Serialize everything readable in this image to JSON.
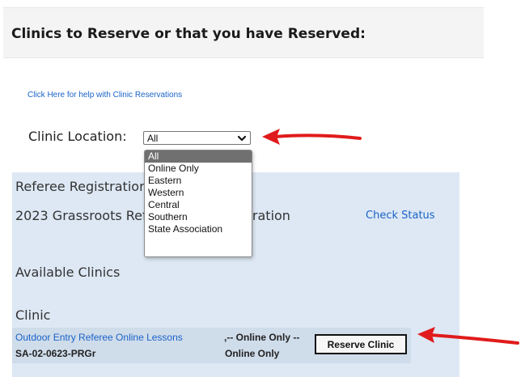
{
  "header": {
    "title": "Clinics to Reserve or that you have Reserved:"
  },
  "help_link": "Click Here for help with Clinic Reservations",
  "location": {
    "label": "Clinic Location:",
    "selected": "All",
    "options": [
      "All",
      "Online Only",
      "Eastern",
      "Western",
      "Central",
      "Southern",
      "State Association"
    ]
  },
  "registration": {
    "title": "Referee Registration",
    "line": "2023   Grassroots Referee New Registration",
    "check_status": "Check Status"
  },
  "available": {
    "heading": "Available Clinics",
    "column_header": "Clinic",
    "rows": [
      {
        "name": "Outdoor Entry Referee Online Lessons",
        "code": "SA-02-0623-PRGr",
        "location_line1": ",-- Online Only --",
        "location_line2": "Online Only",
        "action": "Reserve Clinic"
      }
    ]
  },
  "colors": {
    "link": "#1a63c8",
    "panel": "#dde8f4",
    "row": "#cfdcea",
    "arrow": "#e01b1b",
    "selected_option": "#707070"
  },
  "icons": [
    "chevron-down-icon",
    "red-arrow-annotation"
  ]
}
